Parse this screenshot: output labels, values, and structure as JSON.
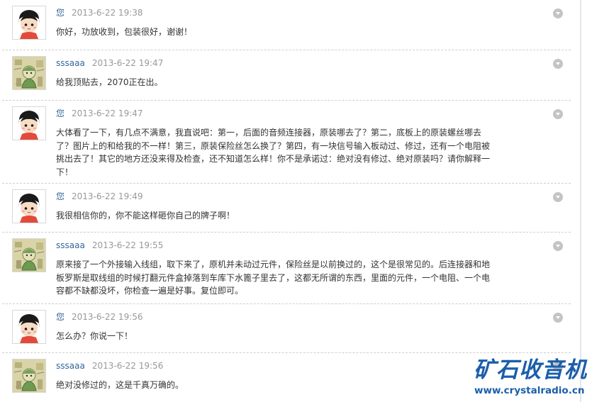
{
  "thread": {
    "comments": [
      {
        "author": "您",
        "avatar": "girl-avatar",
        "time": "2013-6-22 19:38",
        "text": "你好，功放收到，包装很好，谢谢！"
      },
      {
        "author": "sssaaa",
        "avatar": "sketch-avatar",
        "time": "2013-6-22 19:47",
        "text": "给我顶贴去，2070正在出。"
      },
      {
        "author": "您",
        "avatar": "girl-avatar",
        "time": "2013-6-22 19:47",
        "text": "大体看了一下，有几点不满意，我直说吧：第一，后面的音频连接器，原装哪去了？第二，底板上的原装螺丝哪去了？图片上的和给我的不一样！第三，原装保险丝怎么换了？第四，有一块信号输入板动过、修过，还有一个电阻被挑出去了！其它的地方还没来得及检查，还不知道怎么样！你不是承诺过：绝对没有修过、绝对原装吗？请你解释一下！"
      },
      {
        "author": "您",
        "avatar": "girl-avatar",
        "time": "2013-6-22 19:49",
        "text": "我很相信你的，你不能这样砸你自己的牌子啊！"
      },
      {
        "author": "sssaaa",
        "avatar": "sketch-avatar",
        "time": "2013-6-22 19:55",
        "text": "原来接了一个外接输入线组，取下来了，原机并未动过元件，保险丝是以前换过的，这个是很常见的。后连接器和地板罗斯是取线组的时候打翻元件盒掉落到车库下水篦子里去了，这都无所谓的东西，里面的元件，一个电阻、一个电容都不缺都没坏，你检查一遍是好事。复位即可。"
      },
      {
        "author": "您",
        "avatar": "girl-avatar",
        "time": "2013-6-22 19:56",
        "text": "怎么办？你说一下！"
      },
      {
        "author": "sssaaa",
        "avatar": "sketch-avatar",
        "time": "2013-6-22 19:56",
        "text": "绝对没修过的，这是千真万确的。"
      }
    ]
  },
  "watermark": {
    "brand": "矿石收音机",
    "url": "www.crystalradio.cn"
  },
  "colors": {
    "author": "#336699",
    "time": "#999999",
    "watermark": "#1b5eab"
  }
}
